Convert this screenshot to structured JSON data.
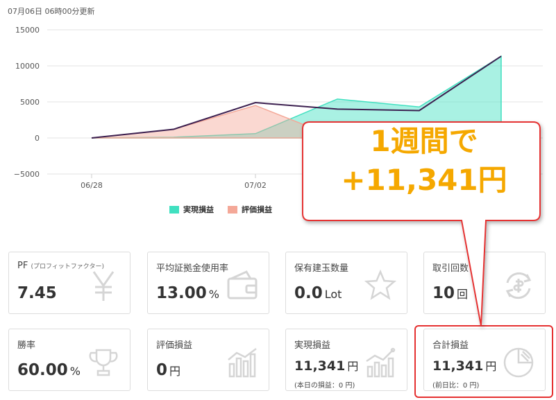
{
  "header": {
    "updated": "07月06日 06時00分更新"
  },
  "chart_data": {
    "type": "area",
    "x_index": [
      0,
      1,
      2,
      3,
      4,
      5
    ],
    "x_tick_labels": [
      {
        "index": 0,
        "label": "06/28"
      },
      {
        "index": 2,
        "label": "07/02"
      }
    ],
    "y_ticks": [
      "15000",
      "10000",
      "5000",
      "0",
      "−5000"
    ],
    "ylim": [
      -5000,
      15000
    ],
    "series": [
      {
        "name": "実現損益",
        "kind": "area",
        "color": "#40e0c0",
        "values": [
          0,
          100,
          600,
          5400,
          4300,
          11341
        ]
      },
      {
        "name": "評価損益",
        "kind": "area",
        "color": "#f4a898",
        "values": [
          0,
          1200,
          4500,
          0,
          0,
          0
        ]
      },
      {
        "name": "合計損益",
        "kind": "line",
        "color": "#3b1f4f",
        "values": [
          0,
          1200,
          4900,
          4000,
          3800,
          11341
        ]
      }
    ],
    "grid": true
  },
  "callout": {
    "line1": "1週間で",
    "line2": "+11,341円"
  },
  "cards": {
    "pf": {
      "title": "PF",
      "title_note": "(プロフィットファクター)",
      "value": "7.45"
    },
    "margin": {
      "title": "平均証拠金使用率",
      "value": "13.00",
      "unit": "%"
    },
    "position": {
      "title": "保有建玉数量",
      "value": "0.0",
      "unit": "Lot"
    },
    "trades": {
      "title": "取引回数",
      "value": "10",
      "unit": "回"
    },
    "winrate": {
      "title": "勝率",
      "value": "60.00",
      "unit": "%"
    },
    "unrealized": {
      "title": "評価損益",
      "value": "0",
      "unit": "円"
    },
    "realized": {
      "title": "実現損益",
      "value": "11,341",
      "unit": "円",
      "sub": "(本日の損益：0 円)"
    },
    "total": {
      "title": "合計損益",
      "value": "11,341",
      "unit": "円",
      "sub": "(前日比：0 円)"
    }
  },
  "icons": [
    "yen-icon",
    "wallet-icon",
    "star-icon",
    "exchange-icon",
    "trophy-icon",
    "bar-chart-icon",
    "growth-chart-icon",
    "pie-chart-icon"
  ]
}
